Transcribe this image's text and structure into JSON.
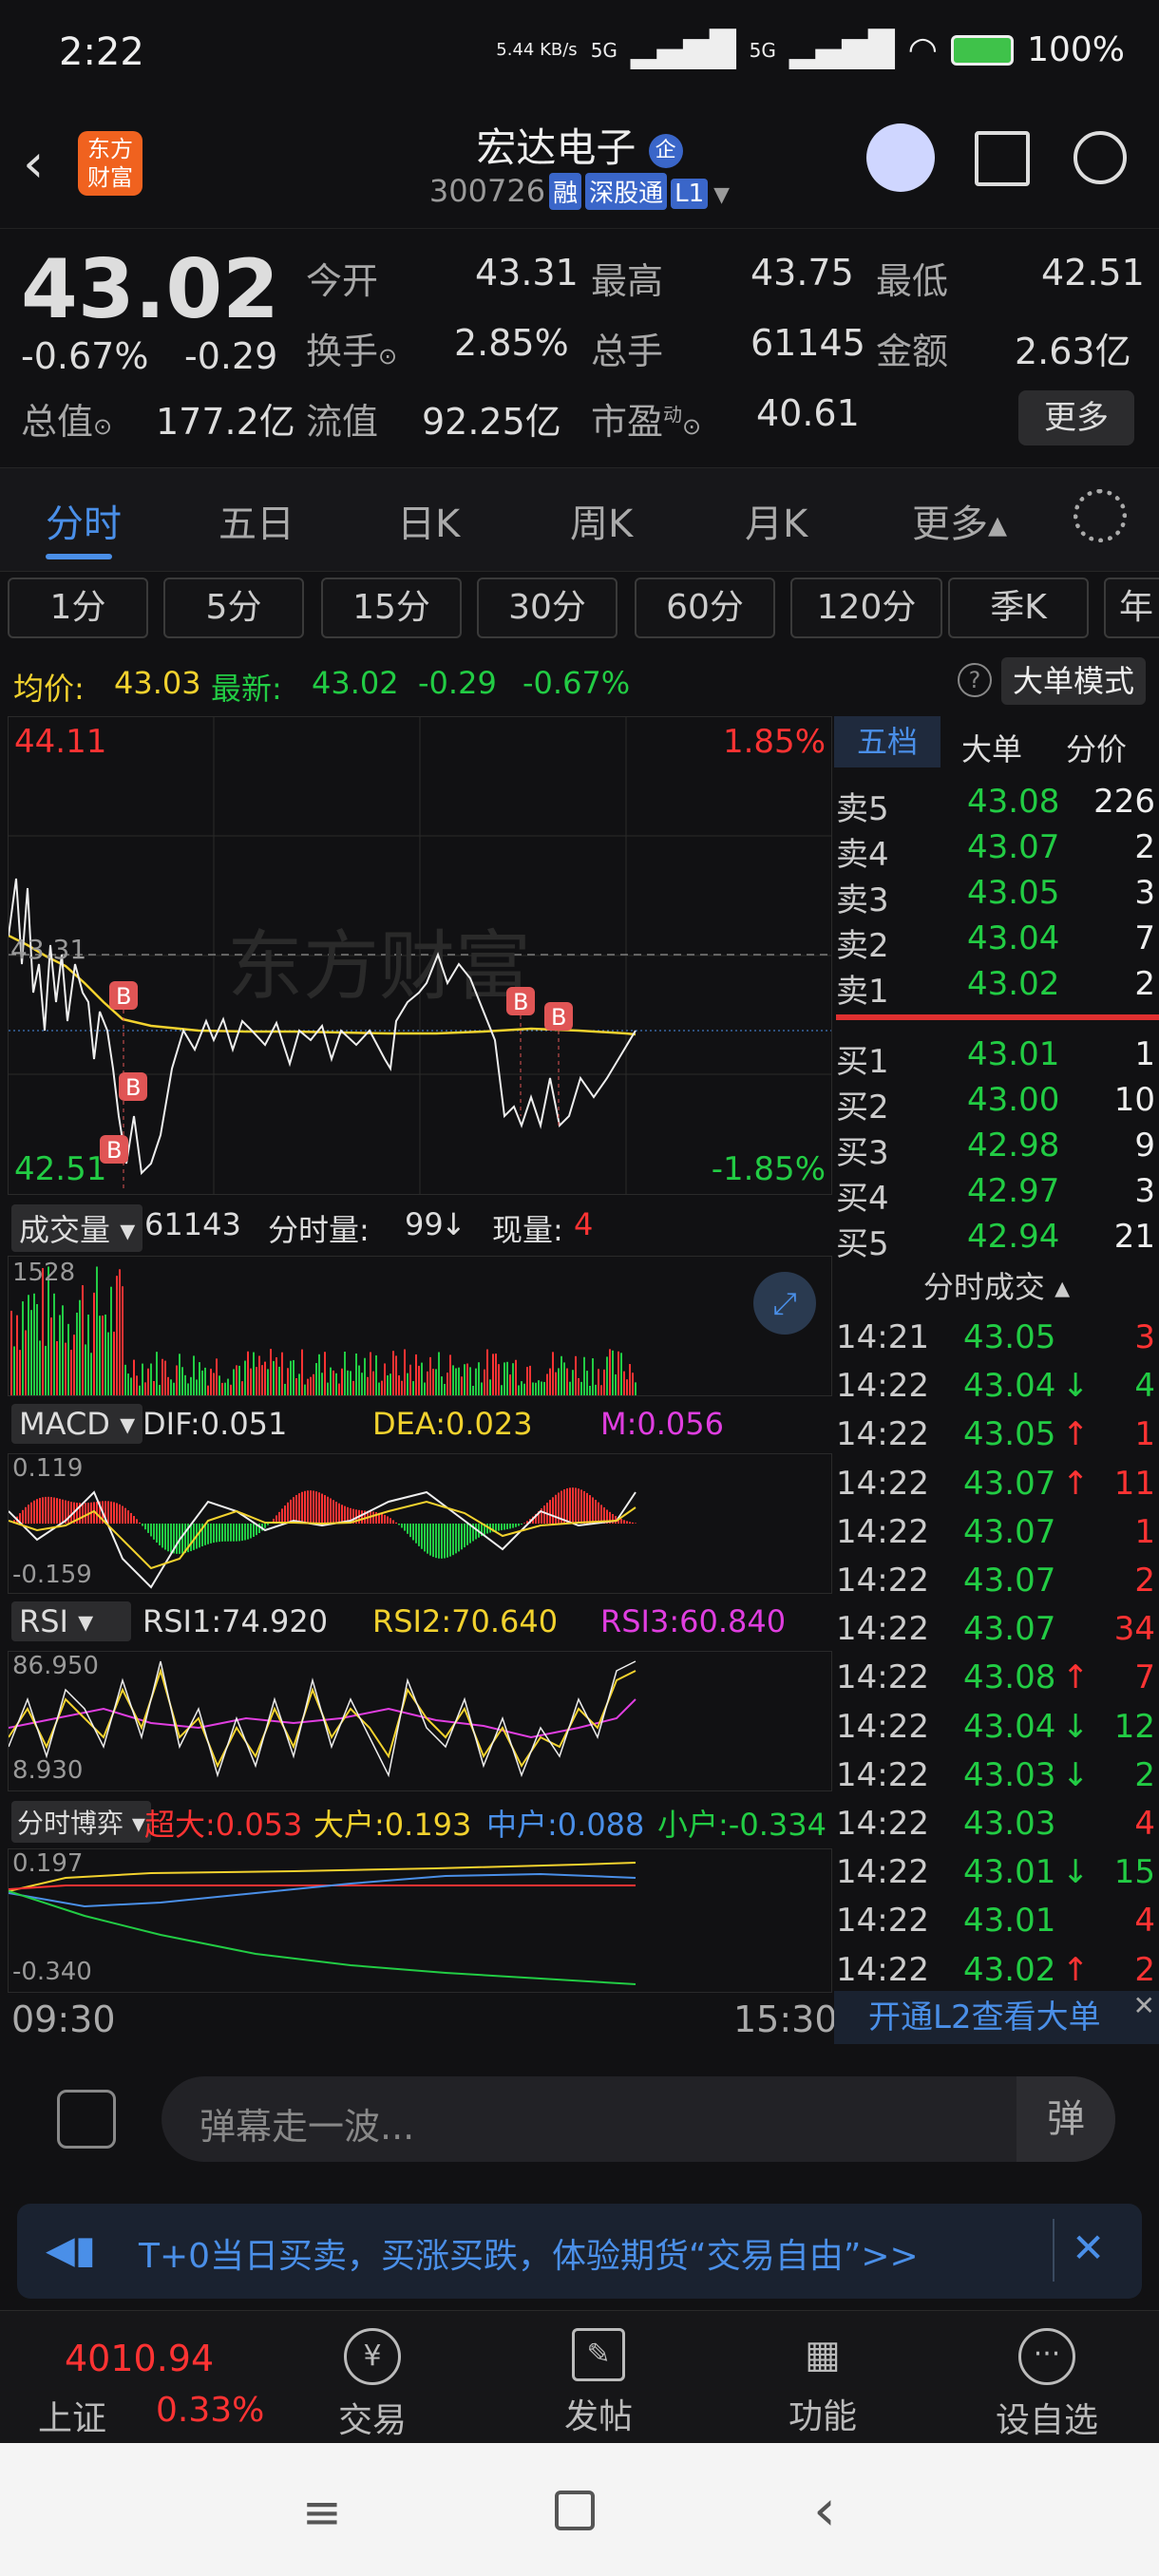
{
  "status": {
    "time": "2:22",
    "speed": "5.44 KB/s",
    "net1": "5G",
    "net2": "5G",
    "battery": "100%"
  },
  "header": {
    "title": "宏达电子",
    "badge": "企",
    "code": "300726",
    "tags": [
      "融",
      "深股通",
      "L1"
    ],
    "logo": "东方财富"
  },
  "quote": {
    "price": "43.02",
    "pct": "-0.67%",
    "chg": "-0.29",
    "open_label": "今开",
    "open": "43.31",
    "high_label": "最高",
    "high": "43.75",
    "low_label": "最低",
    "low": "42.51",
    "turnover_label": "换手",
    "turnover": "2.85%",
    "vol_label": "总手",
    "vol": "61145",
    "amt_label": "金额",
    "amt": "2.63亿",
    "mcap_label": "总值",
    "mcap": "177.2亿",
    "float_label": "流值",
    "float": "92.25亿",
    "pe_label": "市盈",
    "pe_sup": "动",
    "pe": "40.61",
    "more": "更多"
  },
  "tabs": [
    "分时",
    "五日",
    "日K",
    "周K",
    "月K",
    "更多▴"
  ],
  "periods": [
    "1分",
    "5分",
    "15分",
    "30分",
    "60分",
    "120分",
    "季K",
    "年"
  ],
  "avg": {
    "avg_label": "均价:",
    "avg": "43.03",
    "last_label": "最新:",
    "last": "43.02",
    "chg": "-0.29",
    "pct": "-0.67%",
    "mode": "大单模式"
  },
  "chart": {
    "top": "44.11",
    "bottom": "42.51",
    "top_pct": "1.85%",
    "bottom_pct": "-1.85%",
    "watermark": "东方财富",
    "prev_label": "43.31",
    "time_start": "09:30",
    "time_end": "15:30"
  },
  "volume": {
    "label": "成交量",
    "total": "61143",
    "fen_label": "分时量:",
    "fen": "99",
    "xian_label": "现量:",
    "xian": "4",
    "max": "1528"
  },
  "macd": {
    "label": "MACD",
    "dif": "DIF:0.051",
    "dea": "DEA:0.023",
    "m": "M:0.056",
    "top": "0.119",
    "bottom": "-0.159"
  },
  "rsi": {
    "label": "RSI",
    "r1": "RSI1:74.920",
    "r2": "RSI2:70.640",
    "r3": "RSI3:60.840",
    "top": "86.950",
    "bottom": "8.930"
  },
  "fsbo": {
    "label": "分时博弈",
    "chaoda": "超大:0.053",
    "dahu": "大户:0.193",
    "zhonghu": "中户:0.088",
    "xiaohu": "小户:-0.334",
    "top": "0.197",
    "bottom": "-0.340"
  },
  "side_tabs": [
    "五档",
    "大单",
    "分价"
  ],
  "asks": [
    {
      "l": "卖5",
      "p": "43.08",
      "v": "226"
    },
    {
      "l": "卖4",
      "p": "43.07",
      "v": "2"
    },
    {
      "l": "卖3",
      "p": "43.05",
      "v": "3"
    },
    {
      "l": "卖2",
      "p": "43.04",
      "v": "7"
    },
    {
      "l": "卖1",
      "p": "43.02",
      "v": "2"
    }
  ],
  "bids": [
    {
      "l": "买1",
      "p": "43.01",
      "v": "1"
    },
    {
      "l": "买2",
      "p": "43.00",
      "v": "10"
    },
    {
      "l": "买3",
      "p": "42.98",
      "v": "9"
    },
    {
      "l": "买4",
      "p": "42.97",
      "v": "3"
    },
    {
      "l": "买5",
      "p": "42.94",
      "v": "21"
    }
  ],
  "trades_title": "分时成交",
  "trades": [
    {
      "t": "14:21",
      "p": "43.05",
      "v": "3",
      "a": ""
    },
    {
      "t": "14:22",
      "p": "43.04",
      "v": "4",
      "a": "↓"
    },
    {
      "t": "14:22",
      "p": "43.05",
      "v": "1",
      "a": "↑"
    },
    {
      "t": "14:22",
      "p": "43.07",
      "v": "11",
      "a": "↑"
    },
    {
      "t": "14:22",
      "p": "43.07",
      "v": "1",
      "a": ""
    },
    {
      "t": "14:22",
      "p": "43.07",
      "v": "2",
      "a": ""
    },
    {
      "t": "14:22",
      "p": "43.07",
      "v": "34",
      "a": ""
    },
    {
      "t": "14:22",
      "p": "43.08",
      "v": "7",
      "a": "↑"
    },
    {
      "t": "14:22",
      "p": "43.04",
      "v": "12",
      "a": "↓"
    },
    {
      "t": "14:22",
      "p": "43.03",
      "v": "2",
      "a": "↓"
    },
    {
      "t": "14:22",
      "p": "43.03",
      "v": "4",
      "a": ""
    },
    {
      "t": "14:22",
      "p": "43.01",
      "v": "15",
      "a": "↓"
    },
    {
      "t": "14:22",
      "p": "43.01",
      "v": "4",
      "a": ""
    },
    {
      "t": "14:22",
      "p": "43.02",
      "v": "2",
      "a": "↑"
    }
  ],
  "l2": "开通L2查看大单",
  "danmu_placeholder": "弹幕走一波...",
  "danmu_btn": "弹",
  "banner": "T+0当日买卖，买涨买跌，体验期货“交易自由”>>",
  "index": {
    "value": "4010.94",
    "name": "上证",
    "pct": "0.33%"
  },
  "nav": [
    "交易",
    "发帖",
    "功能",
    "设自选"
  ],
  "colors": {
    "up": "#ff3333",
    "down": "#22cc44",
    "avg": "#f2d22e",
    "accent": "#3a66c9"
  }
}
